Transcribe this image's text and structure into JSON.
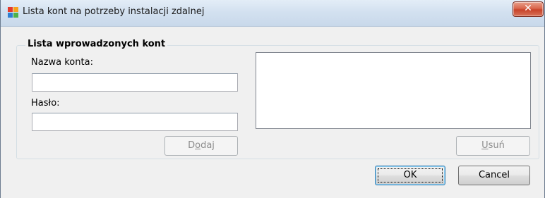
{
  "window": {
    "title": "Lista kont na potrzeby instalacji zdalnej",
    "app_icon": "avg-logo-icon",
    "close_icon": "close-icon",
    "close_glyph": "✕"
  },
  "group": {
    "title": "Lista wprowadzonych kont",
    "account_name_label": "Nazwa konta:",
    "account_name_value": "",
    "password_label": "Hasło:",
    "password_value": "",
    "accounts": []
  },
  "buttons": {
    "add": {
      "before": "D",
      "mnemonic": "o",
      "after": "daj",
      "enabled": false
    },
    "remove": {
      "before": "",
      "mnemonic": "U",
      "after": "suń",
      "enabled": false
    },
    "ok": "OK",
    "cancel": "Cancel"
  },
  "colors": {
    "close_button": "#c8432a",
    "default_button_border": "#3c7fb1",
    "disabled_text": "#8d8d8d"
  }
}
